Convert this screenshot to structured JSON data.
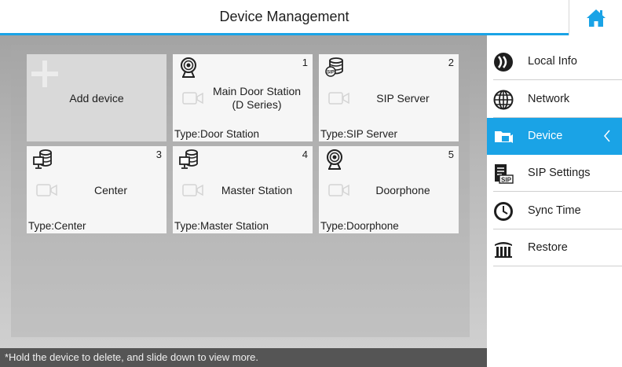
{
  "header": {
    "title": "Device Management",
    "home_icon": "home-icon"
  },
  "colors": {
    "accent": "#1aa3e6",
    "footer_bg": "#555555",
    "card_bg": "#f6f6f6",
    "add_card_bg": "#d9d9d9"
  },
  "add_device": {
    "label": "Add device",
    "icon": "plus-icon"
  },
  "devices": [
    {
      "number": "1",
      "name": "Main Door Station\n(D Series)",
      "type": "Type:Door Station",
      "icon": "door-station-icon"
    },
    {
      "number": "2",
      "name": "SIP Server",
      "type": "Type:SIP Server",
      "icon": "sip-server-icon"
    },
    {
      "number": "3",
      "name": "Center",
      "type": "Type:Center",
      "icon": "center-icon"
    },
    {
      "number": "4",
      "name": "Master Station",
      "type": "Type:Master Station",
      "icon": "master-station-icon"
    },
    {
      "number": "5",
      "name": "Doorphone",
      "type": "Type:Doorphone",
      "icon": "doorphone-icon"
    }
  ],
  "footer": {
    "hint": "*Hold the device to delete, and slide down to view more."
  },
  "sidebar": {
    "items": [
      {
        "label": "Local Info",
        "icon": "local-info-icon",
        "active": false
      },
      {
        "label": "Network",
        "icon": "globe-icon",
        "active": false
      },
      {
        "label": "Device",
        "icon": "device-folder-icon",
        "active": true
      },
      {
        "label": "SIP Settings",
        "icon": "sip-settings-icon",
        "active": false
      },
      {
        "label": "Sync Time",
        "icon": "clock-icon",
        "active": false
      },
      {
        "label": "Restore",
        "icon": "restore-icon",
        "active": false
      }
    ]
  }
}
